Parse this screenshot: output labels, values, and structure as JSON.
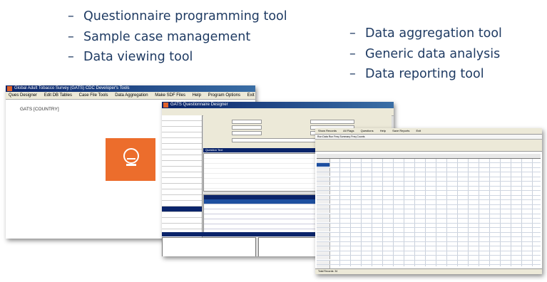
{
  "features_left": [
    {
      "dash": "–",
      "text": "Questionnaire programming tool"
    },
    {
      "dash": "–",
      "text": "Sample case management"
    },
    {
      "dash": "–",
      "text": "Data viewing tool"
    }
  ],
  "features_right": [
    {
      "dash": "–",
      "text": "Data aggregation tool"
    },
    {
      "dash": "–",
      "text": "Generic data analysis"
    },
    {
      "dash": "–",
      "text": "Data reporting tool"
    }
  ],
  "window_main": {
    "title": "Global Adult Tobacco Survey (GATS) CDC Developer's Tools",
    "menu": [
      "Ques Designer",
      "Edit DB Tables",
      "Case File Tools",
      "Data Aggregation",
      "Make SDF Files",
      "Help",
      "Program Options",
      "Exit"
    ],
    "country_label": "GATS [COUNTRY]",
    "logo_icon": "globe-icon",
    "accent": "#ec6d2c"
  },
  "window_designer": {
    "title": "GATS Questionnaire Designer",
    "section_band": "Question Text",
    "sidebar_rows": 27,
    "sidebar_selected_index": 16
  },
  "window_viewer": {
    "menu": [
      "Show Records",
      "All Flags",
      "Questions",
      "Help",
      "Save Reports",
      "Exit"
    ],
    "tabs": "Run Data  Run Freq  Summary  Freq Counts",
    "status": "Total Records: 34",
    "rows": 28,
    "selected_row_index": 1
  }
}
